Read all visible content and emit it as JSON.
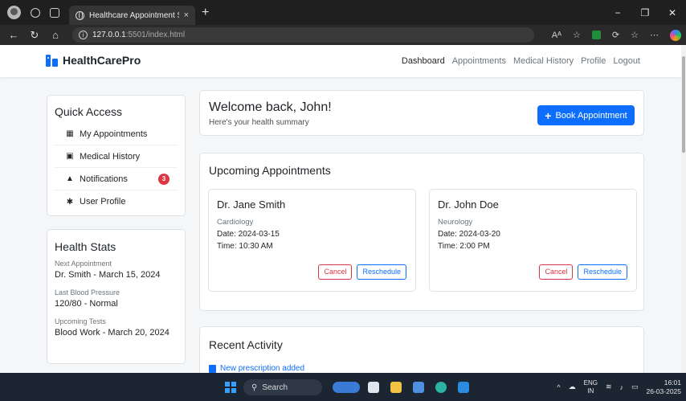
{
  "browser": {
    "tab_title": "Healthcare Appointment System",
    "tab_close": "×",
    "new_tab": "+",
    "url_host": "127.0.0.1",
    "url_path": ":5501/index.html",
    "win_min": "−",
    "win_max": "❐",
    "win_close": "✕"
  },
  "app": {
    "brand": "HealthCarePro",
    "nav": [
      "Dashboard",
      "Appointments",
      "Medical History",
      "Profile",
      "Logout"
    ]
  },
  "quick_access": {
    "title": "Quick Access",
    "items": [
      {
        "label": "My Appointments",
        "icon": "calendar-icon"
      },
      {
        "label": "Medical History",
        "icon": "file-medical-icon"
      },
      {
        "label": "Notifications",
        "icon": "bell-icon",
        "badge": "3"
      },
      {
        "label": "User Profile",
        "icon": "gear-icon"
      }
    ]
  },
  "health_stats": {
    "title": "Health Stats",
    "items": [
      {
        "label": "Next Appointment",
        "value": "Dr. Smith - March 15, 2024"
      },
      {
        "label": "Last Blood Pressure",
        "value": "120/80 - Normal"
      },
      {
        "label": "Upcoming Tests",
        "value": "Blood Work - March 20, 2024"
      }
    ]
  },
  "welcome": {
    "title": "Welcome back, John!",
    "subtitle": "Here's your health summary",
    "book_button": "Book Appointment"
  },
  "upcoming": {
    "title": "Upcoming Appointments",
    "appointments": [
      {
        "doctor": "Dr. Jane Smith",
        "specialty": "Cardiology",
        "date": "Date: 2024-03-15",
        "time": "Time: 10:30 AM",
        "cancel": "Cancel",
        "reschedule": "Reschedule"
      },
      {
        "doctor": "Dr. John Doe",
        "specialty": "Neurology",
        "date": "Date: 2024-03-20",
        "time": "Time: 2:00 PM",
        "cancel": "Cancel",
        "reschedule": "Reschedule"
      }
    ]
  },
  "recent": {
    "title": "Recent Activity",
    "items": [
      "New prescription added"
    ]
  },
  "taskbar": {
    "search_placeholder": "Search",
    "lang_1": "ENG",
    "lang_2": "IN",
    "time": "16:01",
    "date": "26-03-2025"
  },
  "colors": {
    "primary": "#0d6efd",
    "danger": "#dc3545"
  }
}
